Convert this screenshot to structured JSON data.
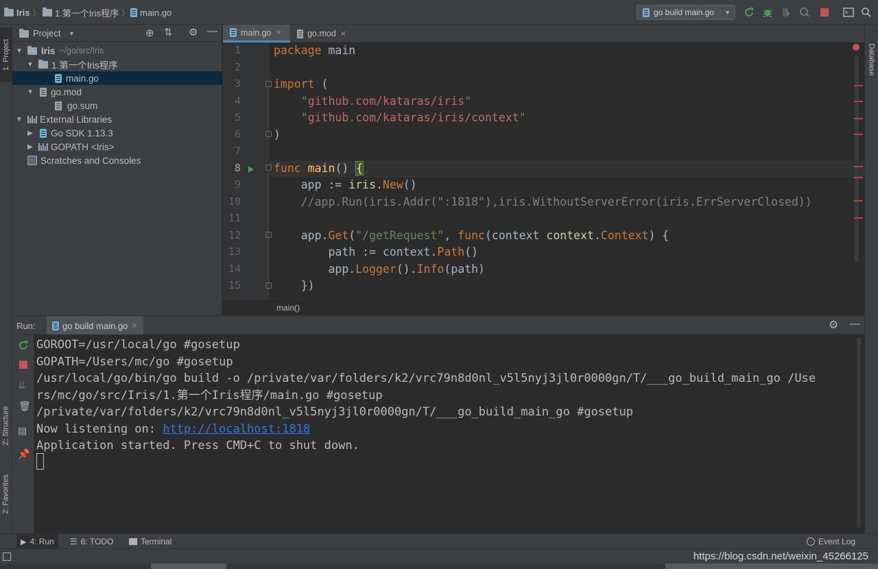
{
  "navbar": {
    "crumbs": [
      "Iris",
      "1.第一个Iris程序",
      "main.go"
    ],
    "run_config": "go build main.go"
  },
  "left_stripe": {
    "project_tab": "1: Project",
    "structure_tab": "Z: Structure",
    "favorites_tab": "2: Favorites"
  },
  "right_stripe": {
    "database_tab": "Database"
  },
  "project": {
    "title": "Project",
    "tree": [
      {
        "label": "Iris",
        "path": "~/go/src/Iris"
      },
      {
        "label": "1.第一个Iris程序"
      },
      {
        "label": "main.go"
      },
      {
        "label": "go.mod"
      },
      {
        "label": "go.sum"
      },
      {
        "label": "External Libraries"
      },
      {
        "label": "Go SDK 1.13.3"
      },
      {
        "label": "GOPATH <Iris>"
      },
      {
        "label": "Scratches and Consoles"
      }
    ]
  },
  "editor": {
    "tabs": [
      "main.go",
      "go.mod"
    ],
    "line_numbers": [
      "1",
      "2",
      "3",
      "4",
      "5",
      "6",
      "7",
      "8",
      "9",
      "10",
      "11",
      "12",
      "13",
      "14",
      "15"
    ],
    "code": {
      "l1_kw": "package",
      "l1_rest": " main",
      "l3_kw": "import",
      "l3_rest": " (",
      "l4_q1": "\"",
      "l4_path": "github.com/kataras/iris",
      "l4_q2": "\"",
      "l5_q1": "\"",
      "l5_path": "github.com/kataras/iris/context",
      "l5_q2": "\"",
      "l6": ")",
      "l8_kw": "func",
      "l8_name": "main",
      "l8_paren": "() ",
      "l8_brace": "{",
      "l9_a": "    app := ",
      "l9_pkg": "iris",
      "l9_dot": ".",
      "l9_fn": "New",
      "l9_end": "()",
      "l10": "    //app.Run(iris.Addr(\":1818\"),iris.WithoutServerError(iris.ErrServerClosed))",
      "l12_a": "    app.",
      "l12_get": "Get",
      "l12_b": "(",
      "l12_str": "\"/getRequest\"",
      "l12_c": ", ",
      "l12_kw": "func",
      "l12_d": "(context ",
      "l12_pkg": "context",
      "l12_dot": ".",
      "l12_type": "Context",
      "l12_e": ") {",
      "l13_a": "        path := context.",
      "l13_fn": "Path",
      "l13_b": "()",
      "l14_a": "        app.",
      "l14_fn1": "Logger",
      "l14_b": "().",
      "l14_fn2": "Info",
      "l14_c": "(path)",
      "l15": "    })"
    },
    "breadcrumb": "main()"
  },
  "run": {
    "label": "Run:",
    "tab": "go build main.go",
    "console": [
      "GOROOT=/usr/local/go #gosetup",
      "GOPATH=/Users/mc/go #gosetup",
      "/usr/local/go/bin/go build -o /private/var/folders/k2/vrc79n8d0nl_v5l5nyj3jl0r0000gn/T/___go_build_main_go /Use",
      "rs/mc/go/src/Iris/1.第一个Iris程序/main.go #gosetup",
      "/private/var/folders/k2/vrc79n8d0nl_v5l5nyj3jl0r0000gn/T/___go_build_main_go #gosetup"
    ],
    "listening_prefix": "Now listening on: ",
    "listening_url": "http://localhost:1818",
    "started": "Application started. Press CMD+C to shut down."
  },
  "bottom_tabs": {
    "run": "4: Run",
    "todo": "6: TODO",
    "terminal": "Terminal",
    "event_log": "Event Log"
  },
  "status": {
    "watermark": "https://blog.csdn.net/weixin_45266125"
  },
  "colors": {
    "accent": "#4a88c7",
    "run_green": "#499c54",
    "stop_red": "#c75450",
    "keyword": "#cc7832",
    "string": "#6a8759",
    "link": "#287bde"
  }
}
